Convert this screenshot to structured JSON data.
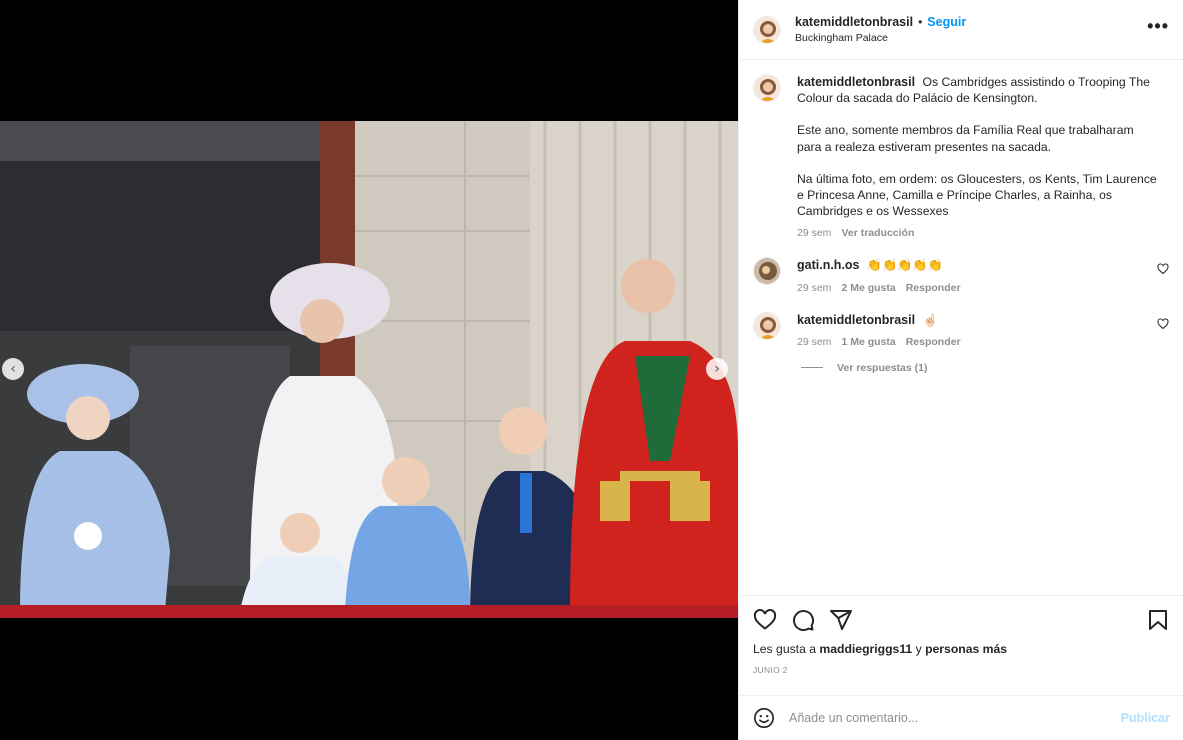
{
  "post": {
    "username": "katemiddletonbrasil",
    "separator": "•",
    "follow_label": "Seguir",
    "location": "Buckingham Palace",
    "more_label": "•••"
  },
  "caption": {
    "username": "katemiddletonbrasil",
    "paragraph1": "Os Cambridges assistindo o Trooping The Colour da sacada do Palácio de Kensington.",
    "paragraph2": "Este ano, somente membros da Família Real que trabalharam para a realeza estiveram presentes na sacada.",
    "paragraph3": "Na última foto, em ordem: os Gloucesters, os Kents, Tim Laurence e Princesa Anne, Camilla e Príncipe Charles, a Rainha, os Cambridges e os Wessexes",
    "time": "29 sem",
    "translate": "Ver traducción"
  },
  "comments": [
    {
      "username": "gati.n.h.os",
      "text": "👏👏👏👏👏",
      "time": "29 sem",
      "likes": "2 Me gusta",
      "reply": "Responder"
    },
    {
      "username": "katemiddletonbrasil",
      "text": "☝🏻",
      "time": "29 sem",
      "likes": "1 Me gusta",
      "reply": "Responder"
    }
  ],
  "view_replies": "Ver respuestas (1)",
  "likes_line": {
    "prefix": "Les gusta a ",
    "user": "maddiegriggs11",
    "middle": " y ",
    "rest": "personas más"
  },
  "date": "JUNIO 2",
  "add_comment": {
    "placeholder": "Añade un comentario...",
    "publish": "Publicar"
  },
  "carousel": {
    "prev_icon": "‹",
    "next_icon": "›"
  },
  "colors": {
    "accent": "#0095f6",
    "publish_disabled": "#b2dffc",
    "muted": "#8e8e8e"
  }
}
